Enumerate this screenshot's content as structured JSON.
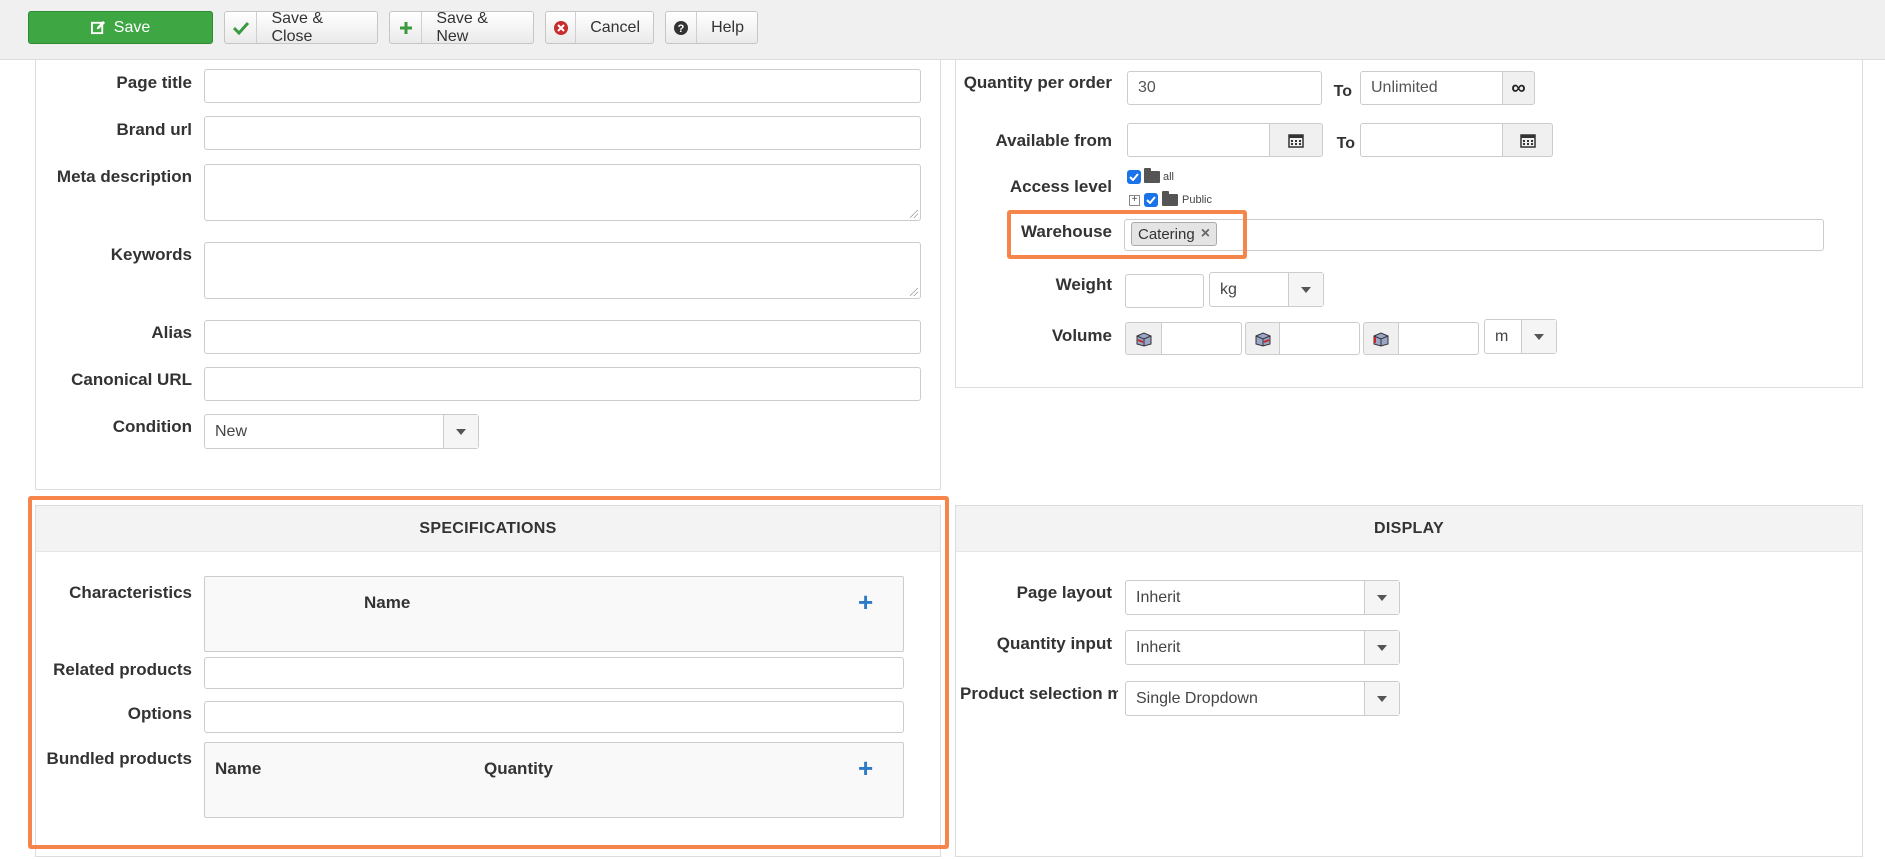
{
  "toolbar": {
    "save": "Save",
    "save_close": "Save & Close",
    "save_new": "Save & New",
    "cancel": "Cancel",
    "help": "Help"
  },
  "seo": {
    "page_title_label": "Page title",
    "brand_url_label": "Brand url",
    "meta_description_label": "Meta description",
    "keywords_label": "Keywords",
    "alias_label": "Alias",
    "canonical_url_label": "Canonical URL",
    "condition_label": "Condition",
    "condition_value": "New"
  },
  "stock": {
    "quantity_per_order_label": "Quantity per order",
    "quantity_min": "30",
    "to_label": "To",
    "quantity_max": "Unlimited",
    "available_from_label": "Available from",
    "access_level_label": "Access level",
    "access_tree": [
      "all",
      "Public"
    ],
    "warehouse_label": "Warehouse",
    "warehouse_tag": "Catering",
    "weight_label": "Weight",
    "weight_unit": "kg",
    "volume_label": "Volume",
    "volume_unit": "m"
  },
  "specifications": {
    "title": "SPECIFICATIONS",
    "characteristics_label": "Characteristics",
    "characteristics_col_name": "Name",
    "related_products_label": "Related products",
    "options_label": "Options",
    "bundled_products_label": "Bundled products",
    "bundled_col_name": "Name",
    "bundled_col_quantity": "Quantity"
  },
  "display": {
    "title": "DISPLAY",
    "page_layout_label": "Page layout",
    "page_layout_value": "Inherit",
    "quantity_input_label": "Quantity input",
    "quantity_input_value": "Inherit",
    "product_selection_label": "Product selection m",
    "product_selection_value": "Single Dropdown"
  },
  "colors": {
    "save_green": "#3ea643",
    "highlight_orange": "#f5854a",
    "add_blue": "#2f7ac7"
  }
}
